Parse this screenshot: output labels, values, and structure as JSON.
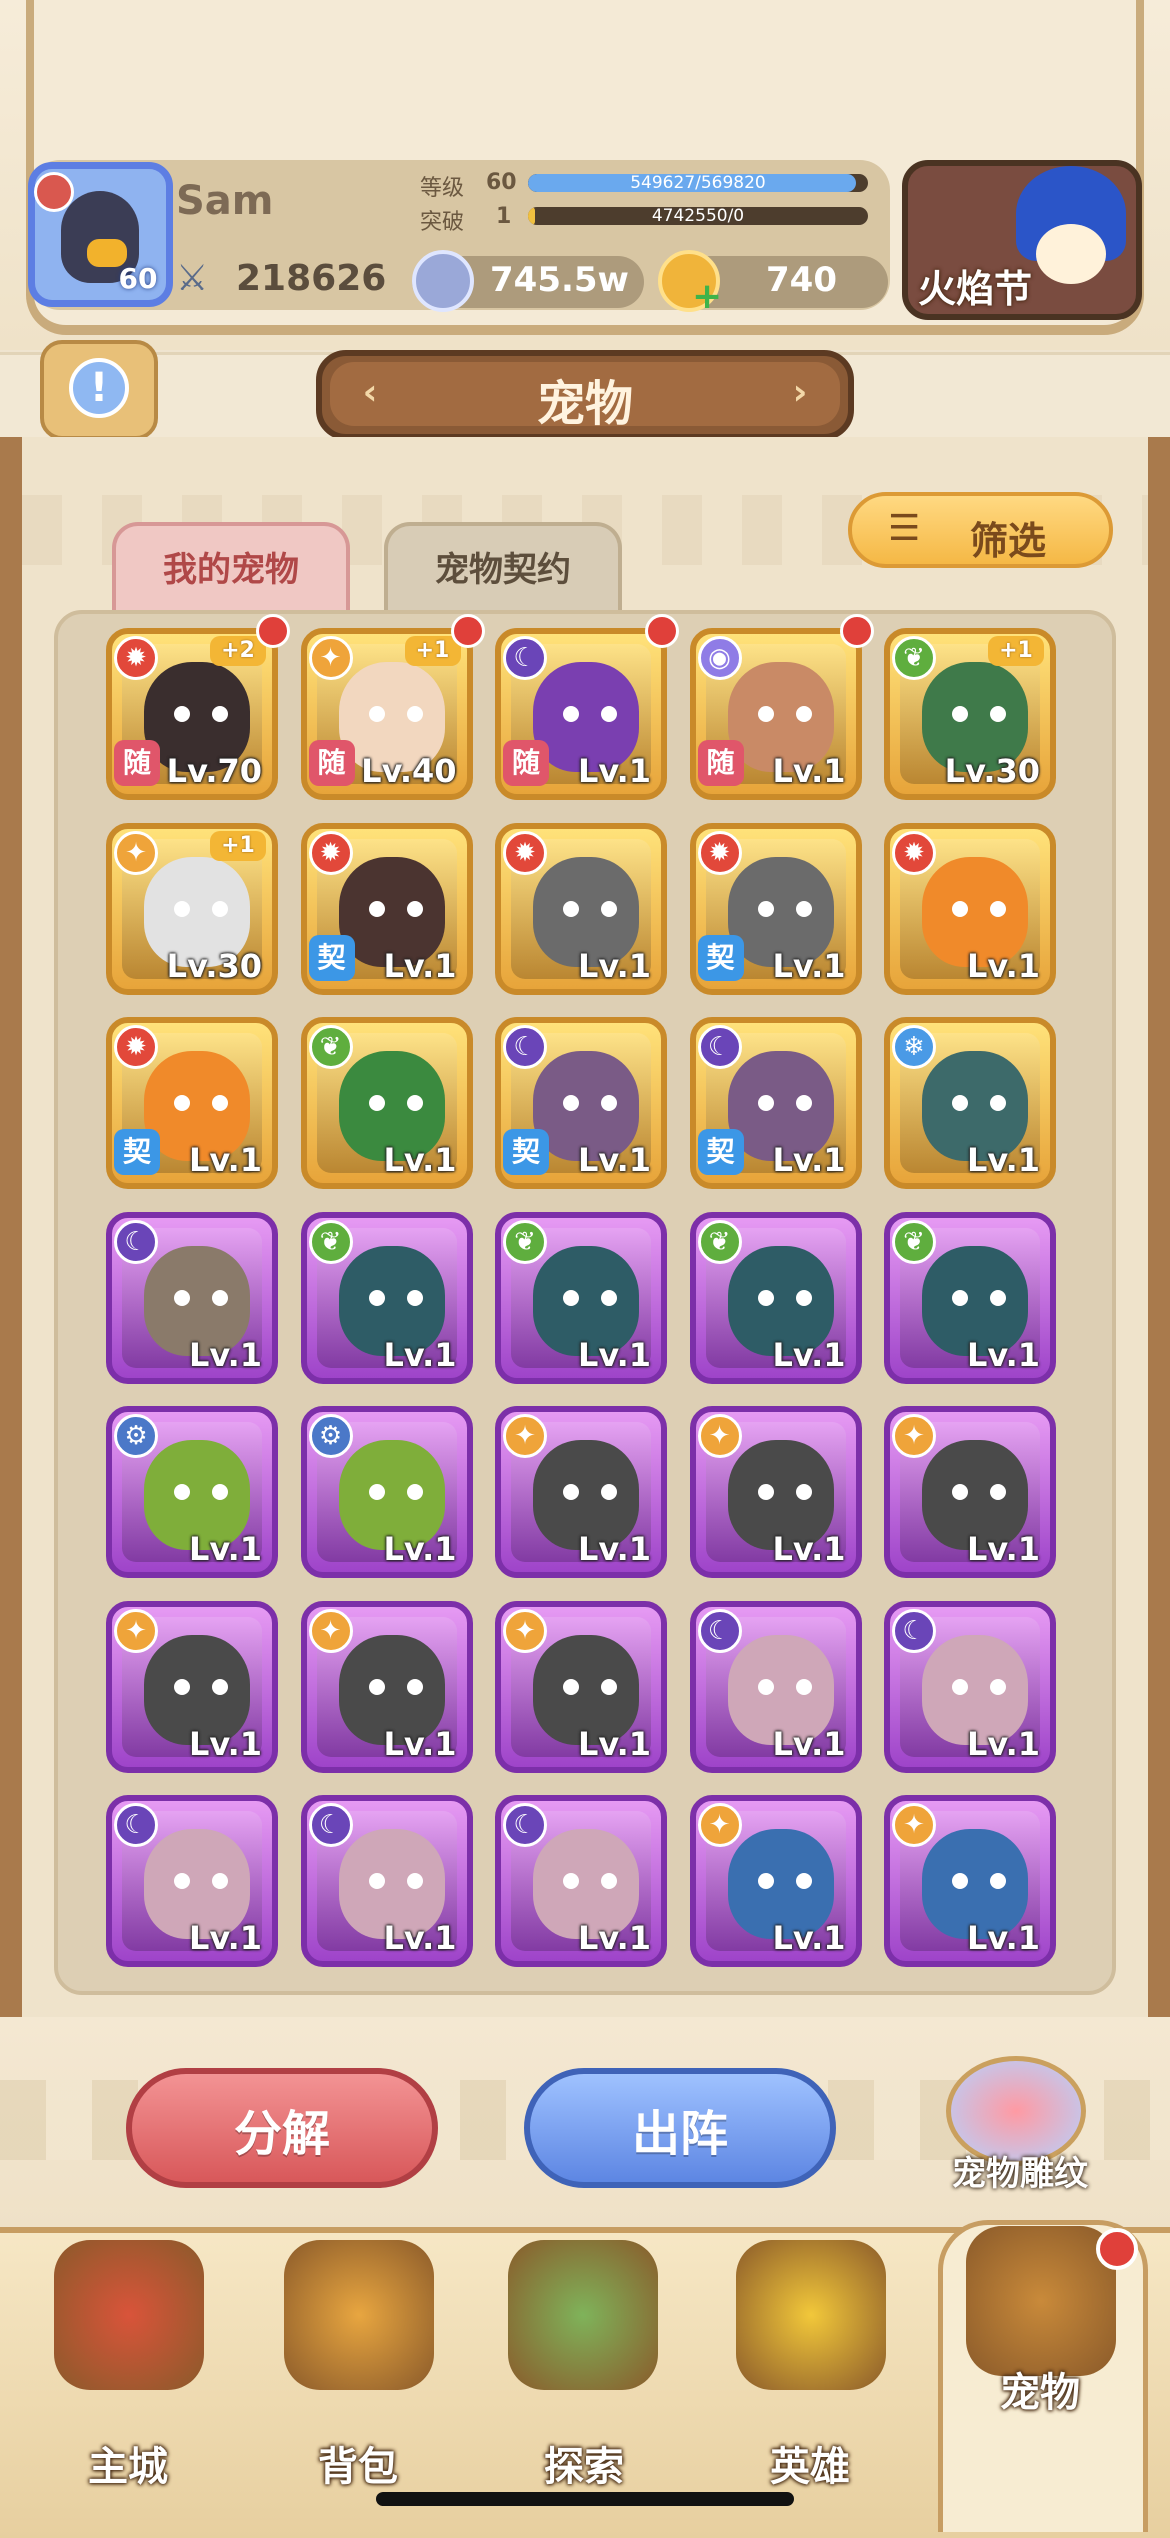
{
  "header": {
    "player_name": "Sam",
    "avatar_level": "60",
    "combat_power": "218626",
    "level_label": "等级",
    "level_value": "60",
    "exp_text": "549627/569820",
    "exp_progress": 0.965,
    "breakthrough_label": "突破",
    "breakthrough_value": "1",
    "breakthrough_text": "4742550/0",
    "breakthrough_progress": 0.02,
    "silver_amount": "745.5w",
    "gold_amount": "740",
    "event_label": "火焰节"
  },
  "title": {
    "text": "宠物",
    "left_arrow": "‹",
    "right_arrow": "›"
  },
  "tabs": [
    {
      "label": "我的宠物",
      "active": true
    },
    {
      "label": "宠物契约",
      "active": false
    }
  ],
  "filter_label": "筛选",
  "filter_icon": "list-icon",
  "element_colors": {
    "fire": "#e2483a",
    "light": "#efa43a",
    "dark": "#6a45b8",
    "psychic": "#8f7ce6",
    "nature": "#5fae3e",
    "ice": "#4a9ae6",
    "mech": "#4b78c8"
  },
  "pets": [
    {
      "level": "Lv.70",
      "element": "fire",
      "rarity": "gold",
      "star": "+2",
      "tag": "随",
      "dot": true,
      "art": "#3a2e2e"
    },
    {
      "level": "Lv.40",
      "element": "light",
      "rarity": "gold",
      "star": "+1",
      "tag": "随",
      "dot": true,
      "art": "#f2d7bf"
    },
    {
      "level": "Lv.1",
      "element": "dark",
      "rarity": "gold",
      "star": "",
      "tag": "随",
      "dot": true,
      "art": "#7a3fb0"
    },
    {
      "level": "Lv.1",
      "element": "psychic",
      "rarity": "gold",
      "star": "",
      "tag": "随",
      "dot": true,
      "art": "#c98a66"
    },
    {
      "level": "Lv.30",
      "element": "nature",
      "rarity": "gold",
      "star": "+1",
      "tag": "",
      "dot": false,
      "art": "#3f7a4a"
    },
    {
      "level": "Lv.30",
      "element": "light",
      "rarity": "gold",
      "star": "+1",
      "tag": "",
      "dot": false,
      "art": "#e2e2e2"
    },
    {
      "level": "Lv.1",
      "element": "fire",
      "rarity": "gold",
      "star": "",
      "tag": "契",
      "dot": false,
      "art": "#4b3430"
    },
    {
      "level": "Lv.1",
      "element": "fire",
      "rarity": "gold",
      "star": "",
      "tag": "",
      "dot": false,
      "art": "#6b6b6b"
    },
    {
      "level": "Lv.1",
      "element": "fire",
      "rarity": "gold",
      "star": "",
      "tag": "契",
      "dot": false,
      "art": "#6b6b6b"
    },
    {
      "level": "Lv.1",
      "element": "fire",
      "rarity": "gold",
      "star": "",
      "tag": "",
      "dot": false,
      "art": "#f08a2a"
    },
    {
      "level": "Lv.1",
      "element": "fire",
      "rarity": "gold",
      "star": "",
      "tag": "契",
      "dot": false,
      "art": "#f08a2a"
    },
    {
      "level": "Lv.1",
      "element": "nature",
      "rarity": "gold",
      "star": "",
      "tag": "",
      "dot": false,
      "art": "#3b8a3f"
    },
    {
      "level": "Lv.1",
      "element": "dark",
      "rarity": "gold",
      "star": "",
      "tag": "契",
      "dot": false,
      "art": "#7a5b86"
    },
    {
      "level": "Lv.1",
      "element": "dark",
      "rarity": "gold",
      "star": "",
      "tag": "契",
      "dot": false,
      "art": "#7a5b86"
    },
    {
      "level": "Lv.1",
      "element": "ice",
      "rarity": "gold",
      "star": "",
      "tag": "",
      "dot": false,
      "art": "#3d6a6a"
    },
    {
      "level": "Lv.1",
      "element": "dark",
      "rarity": "purple",
      "star": "",
      "tag": "",
      "dot": false,
      "art": "#8a7a6a"
    },
    {
      "level": "Lv.1",
      "element": "nature",
      "rarity": "purple",
      "star": "",
      "tag": "",
      "dot": false,
      "art": "#2e5c66"
    },
    {
      "level": "Lv.1",
      "element": "nature",
      "rarity": "purple",
      "star": "",
      "tag": "",
      "dot": false,
      "art": "#2e5c66"
    },
    {
      "level": "Lv.1",
      "element": "nature",
      "rarity": "purple",
      "star": "",
      "tag": "",
      "dot": false,
      "art": "#2e5c66"
    },
    {
      "level": "Lv.1",
      "element": "nature",
      "rarity": "purple",
      "star": "",
      "tag": "",
      "dot": false,
      "art": "#2e5c66"
    },
    {
      "level": "Lv.1",
      "element": "mech",
      "rarity": "purple",
      "star": "",
      "tag": "",
      "dot": false,
      "art": "#7fae3a"
    },
    {
      "level": "Lv.1",
      "element": "mech",
      "rarity": "purple",
      "star": "",
      "tag": "",
      "dot": false,
      "art": "#7fae3a"
    },
    {
      "level": "Lv.1",
      "element": "light",
      "rarity": "purple",
      "star": "",
      "tag": "",
      "dot": false,
      "art": "#4a4a4a"
    },
    {
      "level": "Lv.1",
      "element": "light",
      "rarity": "purple",
      "star": "",
      "tag": "",
      "dot": false,
      "art": "#4a4a4a"
    },
    {
      "level": "Lv.1",
      "element": "light",
      "rarity": "purple",
      "star": "",
      "tag": "",
      "dot": false,
      "art": "#4a4a4a"
    },
    {
      "level": "Lv.1",
      "element": "light",
      "rarity": "purple",
      "star": "",
      "tag": "",
      "dot": false,
      "art": "#4a4a4a"
    },
    {
      "level": "Lv.1",
      "element": "light",
      "rarity": "purple",
      "star": "",
      "tag": "",
      "dot": false,
      "art": "#4a4a4a"
    },
    {
      "level": "Lv.1",
      "element": "light",
      "rarity": "purple",
      "star": "",
      "tag": "",
      "dot": false,
      "art": "#4a4a4a"
    },
    {
      "level": "Lv.1",
      "element": "dark",
      "rarity": "purple",
      "star": "",
      "tag": "",
      "dot": false,
      "art": "#cfa7b8"
    },
    {
      "level": "Lv.1",
      "element": "dark",
      "rarity": "purple",
      "star": "",
      "tag": "",
      "dot": false,
      "art": "#cfa7b8"
    },
    {
      "level": "Lv.1",
      "element": "dark",
      "rarity": "purple",
      "star": "",
      "tag": "",
      "dot": false,
      "art": "#cfa7b8"
    },
    {
      "level": "Lv.1",
      "element": "dark",
      "rarity": "purple",
      "star": "",
      "tag": "",
      "dot": false,
      "art": "#cfa7b8"
    },
    {
      "level": "Lv.1",
      "element": "dark",
      "rarity": "purple",
      "star": "",
      "tag": "",
      "dot": false,
      "art": "#cfa7b8"
    },
    {
      "level": "Lv.1",
      "element": "light",
      "rarity": "purple",
      "star": "",
      "tag": "",
      "dot": false,
      "art": "#3a6fb0"
    },
    {
      "level": "Lv.1",
      "element": "light",
      "rarity": "purple",
      "star": "",
      "tag": "",
      "dot": false,
      "art": "#3a6fb0"
    }
  ],
  "actions": {
    "decompose": "分解",
    "deploy": "出阵",
    "engrave": "宠物雕纹"
  },
  "nav": [
    {
      "label": "主城",
      "icon": "castle-icon",
      "color": "#d9543a"
    },
    {
      "label": "背包",
      "icon": "backpack-icon",
      "color": "#e8a640"
    },
    {
      "label": "探索",
      "icon": "map-icon",
      "color": "#7fb35a"
    },
    {
      "label": "英雄",
      "icon": "hero-icon",
      "color": "#f2c83a"
    },
    {
      "label": "宠物",
      "icon": "pet-egg-icon",
      "color": "#c98a3a"
    }
  ]
}
